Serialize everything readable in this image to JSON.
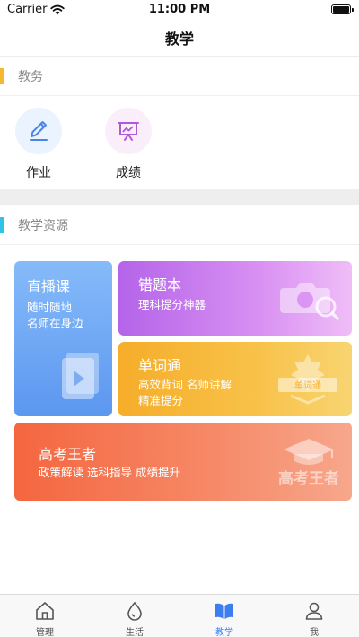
{
  "status_bar": {
    "carrier": "Carrier",
    "time": "11:00 PM"
  },
  "nav": {
    "title": "教学"
  },
  "section_affairs": {
    "title": "教务",
    "accent": "#f7b731"
  },
  "quick_items": [
    {
      "label": "作业",
      "icon": "pencil-icon",
      "bg": "#eaf3fe",
      "color": "#4a86e8"
    },
    {
      "label": "成绩",
      "icon": "chart-board-icon",
      "bg": "#fbeefb",
      "color": "#b05ad8"
    }
  ],
  "section_resources": {
    "title": "教学资源",
    "accent": "#2ec4e6"
  },
  "cards": {
    "live": {
      "title": "直播课",
      "lines": [
        "随时随地",
        "名师在身边"
      ],
      "icon": "video-book-icon"
    },
    "wrong": {
      "title": "错题本",
      "lines": [
        "理科提分神器"
      ],
      "icon": "camera-search-icon"
    },
    "word": {
      "title": "单词通",
      "lines": [
        "高效背词   名师讲解",
        "精准提分"
      ],
      "icon": "word-badge-icon",
      "badge_text": "单词通"
    },
    "exam": {
      "title": "高考王者",
      "lines": [
        "政策解读   选科指导   成绩提升"
      ],
      "icon": "grad-cap-icon",
      "watermark": "高考王者"
    }
  },
  "tabs": [
    {
      "label": "管理",
      "icon": "home-icon",
      "active": false
    },
    {
      "label": "生活",
      "icon": "drop-icon",
      "active": false
    },
    {
      "label": "教学",
      "icon": "open-book-icon",
      "active": true
    },
    {
      "label": "我",
      "icon": "person-icon",
      "active": false
    }
  ]
}
